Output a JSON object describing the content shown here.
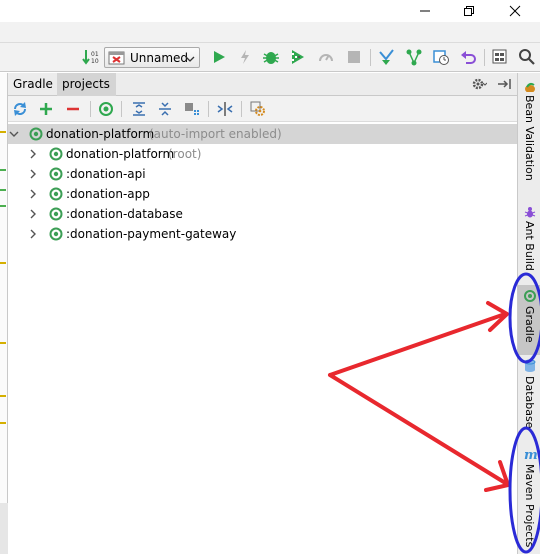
{
  "window": {
    "minimize_icon": "minimize-icon",
    "maximize_icon": "restore-icon",
    "close_icon": "close-icon"
  },
  "toolbar": {
    "run_config": {
      "label": "Unnamed",
      "icon": "run-config-icon"
    },
    "icons": [
      "sort-icon",
      "run-icon",
      "lightning-icon",
      "debug-bug-icon",
      "coverage-icon",
      "profiler-icon",
      "stop-icon",
      "vcs-update-icon",
      "vcs-branch-icon",
      "vcs-history-icon",
      "revert-icon",
      "project-structure-icon",
      "search-icon"
    ]
  },
  "gradle_panel": {
    "title": "Gradle",
    "tab": "projects",
    "toolbar_icons": [
      "refresh-icon",
      "add-icon",
      "remove-icon",
      "execute-task-icon",
      "expand-all-icon",
      "collapse-all-icon",
      "group-modules-icon",
      "toggle-offline-icon",
      "settings-icon"
    ],
    "tree": {
      "root": {
        "label": "donation-platform",
        "hint": "(auto-import enabled)"
      },
      "children": [
        {
          "label": "donation-platform",
          "hint": "(root)"
        },
        {
          "label": ":donation-api",
          "hint": ""
        },
        {
          "label": ":donation-app",
          "hint": ""
        },
        {
          "label": ":donation-database",
          "hint": ""
        },
        {
          "label": ":donation-payment-gateway",
          "hint": ""
        }
      ]
    }
  },
  "right_strip": {
    "tabs": [
      {
        "label": "Bean Validation",
        "icon": "bean-icon",
        "active": false
      },
      {
        "label": "Ant Build",
        "icon": "ant-icon",
        "active": false
      },
      {
        "label": "Gradle",
        "icon": "gradle-icon",
        "active": true
      },
      {
        "label": "Database",
        "icon": "database-icon",
        "active": false
      },
      {
        "label": "Maven Projects",
        "icon": "maven-icon",
        "active": false
      }
    ]
  },
  "colors": {
    "annotation_red": "#e8282e",
    "annotation_blue": "#2a2ad6",
    "gradle_green": "#3c9e55",
    "run_green": "#2fa84f"
  }
}
